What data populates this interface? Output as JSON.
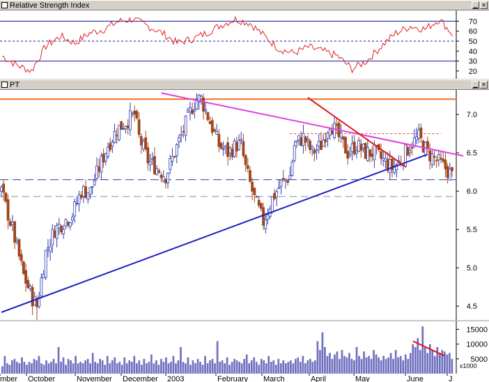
{
  "colors": {
    "candle_up": "#2a3bb0",
    "candle_down": "#a0451c",
    "rsi_line": "#e02020",
    "ref_line": "#1010a0",
    "support_trendline": "#1f1fc0",
    "resistance_trendline": "#e040e0",
    "down_trendline": "#e01818",
    "top_resistance": "#f07020",
    "volume_bar": "#7070c0",
    "dashed_upper": "#e03030",
    "dashed_lower": "#2030a0",
    "dashed_light": "#8090b0"
  },
  "icons": {
    "pane_icon": "window-icon",
    "close": "close-icon",
    "minimize": "minimize-icon"
  },
  "panels": {
    "rsi": {
      "title": "Relative Strength Index",
      "y_ticks": [
        "70",
        "60",
        "50",
        "40",
        "30",
        "20"
      ]
    },
    "price": {
      "title": "PT",
      "y_ticks": [
        "7.0",
        "6.5",
        "6.0",
        "5.5",
        "5.0",
        "4.5"
      ]
    },
    "volume": {
      "y_ticks": [
        "15000",
        "10000",
        "5000"
      ],
      "multiplier": "x1000"
    }
  },
  "x_axis": {
    "labels": [
      "mber",
      "October",
      "November",
      "December",
      "2003",
      "February",
      "March",
      "April",
      "May",
      "June",
      "J"
    ]
  },
  "chart_data": [
    {
      "type": "line",
      "name": "rsi",
      "title": "Relative Strength Index",
      "ylim": [
        15,
        78
      ],
      "reference_levels": [
        70,
        50,
        30
      ],
      "x": [
        0,
        8,
        16,
        24,
        32,
        40,
        48,
        56,
        64,
        72,
        80,
        88,
        96,
        104,
        112,
        120,
        128,
        136,
        144,
        152,
        160,
        168,
        176,
        184,
        192,
        200,
        208,
        216,
        224,
        232,
        240,
        248
      ],
      "values": [
        35,
        26,
        20,
        45,
        55,
        48,
        58,
        62,
        70,
        72,
        65,
        58,
        48,
        52,
        58,
        66,
        72,
        68,
        55,
        42,
        38,
        44,
        40,
        35,
        22,
        30,
        45,
        58,
        65,
        62,
        72,
        55
      ]
    },
    {
      "type": "candlestick",
      "name": "PT",
      "title": "PT",
      "ylim": [
        4.32,
        7.32
      ],
      "x_category_labels": [
        "September",
        "October",
        "November",
        "December",
        "2003",
        "February",
        "March",
        "April",
        "May",
        "June",
        "July"
      ],
      "close_path": [
        [
          0,
          6.0
        ],
        [
          5,
          5.5
        ],
        [
          10,
          4.9
        ],
        [
          14,
          4.6
        ],
        [
          16,
          4.5
        ],
        [
          20,
          5.2
        ],
        [
          24,
          5.5
        ],
        [
          28,
          5.6
        ],
        [
          32,
          5.7
        ],
        [
          36,
          6.0
        ],
        [
          40,
          6.0
        ],
        [
          44,
          6.3
        ],
        [
          48,
          6.6
        ],
        [
          52,
          6.8
        ],
        [
          56,
          6.9
        ],
        [
          60,
          7.0
        ],
        [
          62,
          6.7
        ],
        [
          66,
          6.4
        ],
        [
          70,
          6.3
        ],
        [
          74,
          6.2
        ],
        [
          78,
          6.5
        ],
        [
          82,
          6.8
        ],
        [
          86,
          7.1
        ],
        [
          88,
          7.2
        ],
        [
          90,
          7.2
        ],
        [
          94,
          6.9
        ],
        [
          98,
          6.6
        ],
        [
          102,
          6.5
        ],
        [
          106,
          6.6
        ],
        [
          108,
          6.6
        ],
        [
          110,
          6.3
        ],
        [
          114,
          5.9
        ],
        [
          118,
          5.6
        ],
        [
          122,
          5.9
        ],
        [
          126,
          6.1
        ],
        [
          130,
          6.2
        ],
        [
          132,
          6.6
        ],
        [
          136,
          6.7
        ],
        [
          140,
          6.5
        ],
        [
          144,
          6.6
        ],
        [
          148,
          6.9
        ],
        [
          152,
          6.7
        ],
        [
          156,
          6.5
        ],
        [
          160,
          6.6
        ],
        [
          164,
          6.5
        ],
        [
          168,
          6.5
        ],
        [
          172,
          6.4
        ],
        [
          176,
          6.3
        ],
        [
          180,
          6.4
        ],
        [
          184,
          6.6
        ],
        [
          188,
          6.7
        ],
        [
          192,
          6.5
        ],
        [
          196,
          6.4
        ],
        [
          200,
          6.3
        ],
        [
          203,
          6.2
        ]
      ],
      "horizontal_levels": {
        "resistance_top": 7.2,
        "resistance_dashed": 6.75,
        "support_dashed": 6.15,
        "light_dashed": 5.93
      },
      "trendlines": {
        "support": [
          [
            0,
            4.42
          ],
          [
            192,
            6.48
          ]
        ],
        "resistance": [
          [
            72,
            7.28
          ],
          [
            208,
            6.46
          ]
        ],
        "down": [
          [
            138,
            7.22
          ],
          [
            182,
            6.32
          ]
        ]
      }
    },
    {
      "type": "bar",
      "name": "volume",
      "ylim": [
        0,
        17000
      ],
      "y_unit_multiplier": "x1000",
      "values_by_index": [
        2500,
        6000,
        3500,
        3000,
        4500,
        5000,
        4000,
        3500,
        5500,
        4000,
        3000,
        4000,
        3500,
        5000,
        4500,
        6000,
        3500,
        3000,
        4500,
        3500,
        4000,
        5000,
        3500,
        9000,
        4000,
        5500,
        3000,
        5000,
        4500,
        3500,
        6000,
        3500,
        4000,
        3500,
        4500,
        5000,
        3500,
        7000,
        4000,
        3500,
        5000,
        4500,
        3000,
        6000,
        3500,
        4500,
        5500,
        3500,
        4000,
        3000,
        5500,
        3500,
        4500,
        4000,
        6000,
        3500,
        4500,
        3000,
        5000,
        3500,
        4000,
        6500,
        3500,
        4500,
        3000,
        5000,
        4000,
        5500,
        3500,
        4000,
        6000,
        3500,
        4500,
        9000,
        4000,
        3500,
        5500,
        3000,
        4500,
        3500,
        5000,
        4000,
        3000,
        6000,
        3500,
        4500,
        5000,
        3500,
        11000,
        4000,
        4500,
        3500,
        5500,
        3000,
        4000,
        5000,
        4500,
        4000,
        3500,
        5000,
        6500,
        3500,
        4500,
        5500,
        4000,
        3000,
        5000,
        4500,
        3500,
        6000,
        4000,
        4500,
        3000,
        5000,
        3500,
        4500,
        3500,
        4000,
        4500,
        3500,
        5000,
        5500,
        4000,
        6000,
        3500,
        4500,
        5000,
        4000,
        4500,
        11000,
        8000,
        14000,
        9000,
        6000,
        7000,
        5000,
        6500,
        7500,
        5000,
        8000,
        6000,
        5500,
        7000,
        5000,
        4500,
        9000,
        6000,
        5000,
        7500,
        5500,
        6000,
        5000,
        8000,
        6500,
        5500,
        4500,
        6000,
        5000,
        5500,
        7000,
        5000,
        8000,
        5500,
        6000,
        4500,
        6500,
        5000,
        7000,
        10000,
        9000,
        12000,
        8000,
        16000,
        9000,
        7000,
        10000,
        8000,
        6000,
        9000,
        7000,
        8000,
        7500,
        6500,
        7000,
        5000
      ],
      "trendline": [
        [
          0.905,
          11000
        ],
        [
          0.975,
          6000
        ]
      ]
    }
  ]
}
